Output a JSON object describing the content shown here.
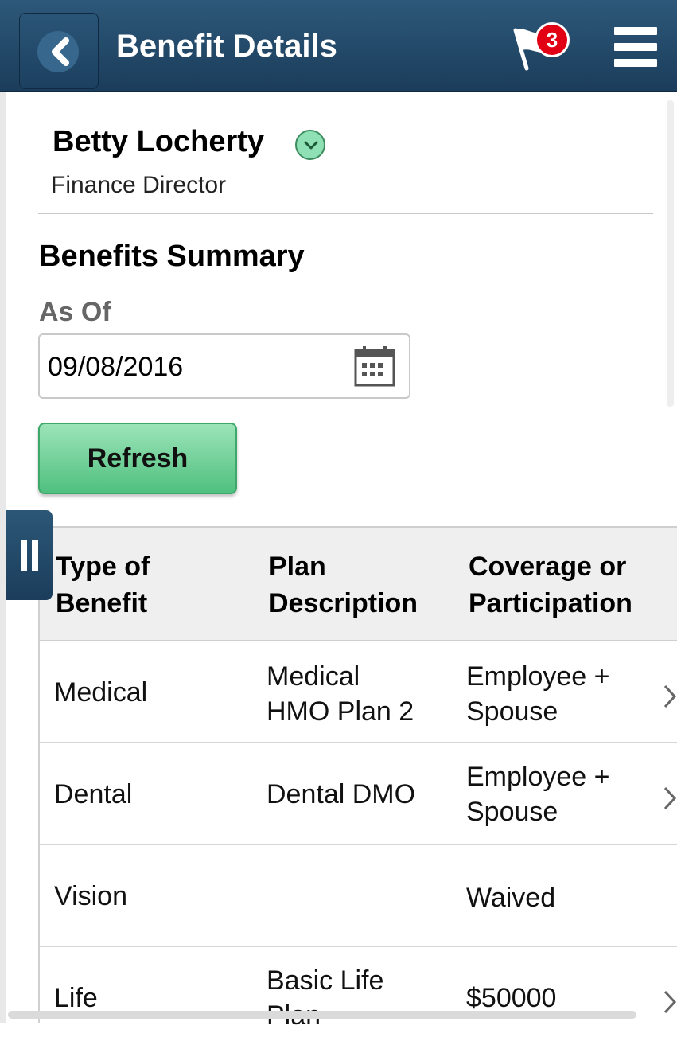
{
  "header": {
    "title": "Benefit Details",
    "notification_count": "3"
  },
  "person": {
    "name": "Betty Locherty",
    "title": "Finance Director"
  },
  "summary": {
    "section_title": "Benefits Summary",
    "as_of_label": "As Of",
    "as_of_value": "09/08/2016",
    "refresh_label": "Refresh"
  },
  "table": {
    "headers": [
      "Type of\nBenefit",
      "Plan\nDescription",
      "Coverage or\nParticipation"
    ],
    "rows": [
      {
        "type": "Medical",
        "plan": "Medical\nHMO Plan 2",
        "coverage": "Employee +\nSpouse",
        "has_detail": true
      },
      {
        "type": "Dental",
        "plan": "Dental DMO",
        "coverage": "Employee +\nSpouse",
        "has_detail": true
      },
      {
        "type": "Vision",
        "plan": "",
        "coverage": "Waived",
        "has_detail": false
      },
      {
        "type": "Life",
        "plan": "Basic Life\nPlan",
        "coverage": "$50000",
        "has_detail": true
      }
    ]
  },
  "icons": {
    "back": "back-arrow-icon",
    "flag": "flag-icon",
    "menu": "hamburger-menu-icon",
    "calendar": "calendar-icon",
    "expand": "chevron-down-icon",
    "row_detail": "chevron-right-icon",
    "side_tab": "pause-bars-icon"
  },
  "colors": {
    "header": "#1f4463",
    "badge": "#e20015",
    "refresh_button": "#6ccf95",
    "expand_icon": "#8fe0b4"
  }
}
